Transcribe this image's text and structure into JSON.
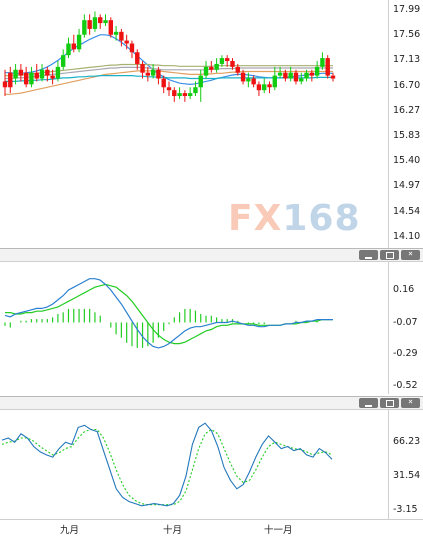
{
  "colors": {
    "up": "#11cc11",
    "down": "#ee1111",
    "ma_blue": "#3a8fe8",
    "ma_orange": "#e0a060",
    "ma_gray": "#a8a8b0",
    "ma_teal": "#18b0c8",
    "ma_olive": "#a8b070",
    "macd_dif": "#2a80d0",
    "macd_dea": "#22cc22",
    "macd_hist": "#22cc22",
    "k_line": "#2277bb",
    "d_line": "#22cc22"
  },
  "watermark": {
    "part1": "FX",
    "part2": "168"
  },
  "panel_buttons": {
    "minimize": "_",
    "restore": "□",
    "close": "×"
  },
  "chart_data": [
    {
      "type": "candlestick",
      "yticks": [
        "17.99",
        "17.56",
        "17.13",
        "16.70",
        "16.27",
        "15.83",
        "15.40",
        "14.97",
        "14.54",
        "14.10"
      ],
      "xticks": [
        "九月",
        "十月",
        "十一月"
      ],
      "ylim": [
        14.1,
        17.99
      ],
      "candles": [
        [
          16.8,
          16.7,
          17.0,
          16.55
        ],
        [
          16.95,
          16.7,
          17.05,
          16.6
        ],
        [
          16.85,
          17.0,
          17.1,
          16.75
        ],
        [
          17.0,
          16.9,
          17.1,
          16.8
        ],
        [
          16.95,
          16.75,
          17.05,
          16.7
        ],
        [
          16.75,
          16.95,
          17.05,
          16.7
        ],
        [
          16.95,
          16.85,
          17.1,
          16.8
        ],
        [
          16.85,
          17.0,
          17.1,
          16.8
        ],
        [
          17.0,
          16.9,
          17.05,
          16.8
        ],
        [
          16.9,
          16.85,
          17.0,
          16.75
        ],
        [
          16.85,
          17.05,
          17.15,
          16.8
        ],
        [
          17.05,
          17.25,
          17.35,
          17.0
        ],
        [
          17.25,
          17.45,
          17.55,
          17.2
        ],
        [
          17.45,
          17.35,
          17.6,
          17.3
        ],
        [
          17.35,
          17.6,
          17.7,
          17.3
        ],
        [
          17.6,
          17.85,
          17.95,
          17.55
        ],
        [
          17.85,
          17.7,
          17.95,
          17.6
        ],
        [
          17.7,
          17.9,
          18.0,
          17.65
        ],
        [
          17.9,
          17.8,
          17.95,
          17.7
        ],
        [
          17.8,
          17.85,
          17.95,
          17.75
        ],
        [
          17.85,
          17.6,
          17.9,
          17.55
        ],
        [
          17.6,
          17.65,
          17.75,
          17.5
        ],
        [
          17.65,
          17.5,
          17.7,
          17.4
        ],
        [
          17.5,
          17.45,
          17.6,
          17.35
        ],
        [
          17.45,
          17.3,
          17.5,
          17.2
        ],
        [
          17.3,
          17.1,
          17.35,
          17.0
        ],
        [
          17.1,
          16.95,
          17.15,
          16.85
        ],
        [
          16.95,
          16.9,
          17.05,
          16.8
        ],
        [
          16.9,
          17.0,
          17.1,
          16.85
        ],
        [
          17.0,
          16.85,
          17.05,
          16.75
        ],
        [
          16.85,
          16.7,
          16.9,
          16.6
        ],
        [
          16.7,
          16.65,
          16.8,
          16.55
        ],
        [
          16.65,
          16.55,
          16.7,
          16.45
        ],
        [
          16.55,
          16.6,
          16.7,
          16.5
        ],
        [
          16.6,
          16.55,
          16.65,
          16.45
        ],
        [
          16.55,
          16.6,
          16.7,
          16.5
        ],
        [
          16.6,
          16.7,
          16.8,
          16.55
        ],
        [
          16.7,
          16.9,
          17.0,
          16.45
        ],
        [
          16.9,
          17.05,
          17.15,
          16.85
        ],
        [
          17.05,
          17.0,
          17.15,
          16.95
        ],
        [
          17.0,
          17.1,
          17.2,
          16.95
        ],
        [
          17.1,
          17.2,
          17.25,
          17.05
        ],
        [
          17.2,
          17.15,
          17.25,
          17.05
        ],
        [
          17.15,
          17.05,
          17.2,
          17.0
        ],
        [
          17.05,
          16.95,
          17.1,
          16.9
        ],
        [
          16.95,
          16.8,
          17.0,
          16.75
        ],
        [
          16.8,
          16.85,
          16.95,
          16.7
        ],
        [
          16.85,
          16.75,
          16.9,
          16.7
        ],
        [
          16.75,
          16.65,
          16.8,
          16.55
        ],
        [
          16.65,
          16.75,
          16.85,
          16.6
        ],
        [
          16.75,
          16.7,
          16.8,
          16.6
        ],
        [
          16.7,
          16.9,
          17.05,
          16.65
        ],
        [
          16.9,
          16.95,
          17.05,
          16.85
        ],
        [
          16.95,
          16.85,
          17.0,
          16.8
        ],
        [
          16.85,
          16.95,
          17.05,
          16.8
        ],
        [
          16.95,
          16.8,
          17.0,
          16.75
        ],
        [
          16.8,
          16.85,
          16.95,
          16.75
        ],
        [
          16.85,
          16.95,
          17.0,
          16.8
        ],
        [
          16.95,
          16.9,
          17.0,
          16.8
        ],
        [
          16.9,
          17.05,
          17.15,
          16.85
        ],
        [
          17.05,
          17.2,
          17.3,
          17.0
        ],
        [
          17.2,
          16.9,
          17.25,
          16.85
        ],
        [
          16.9,
          16.85,
          16.95,
          16.8
        ]
      ],
      "ma": [
        {
          "color_key": "ma_blue",
          "values": [
            16.95,
            16.95,
            16.94,
            16.94,
            16.95,
            16.96,
            16.98,
            17.01,
            17.05,
            17.1,
            17.16,
            17.23,
            17.3,
            17.37,
            17.42,
            17.47,
            17.52,
            17.56,
            17.6,
            17.6,
            17.58,
            17.53,
            17.47,
            17.4,
            17.32,
            17.24,
            17.16,
            17.08,
            17.0,
            16.93,
            16.88,
            16.83,
            16.8,
            16.77,
            16.76,
            16.75,
            16.76,
            16.78,
            16.8,
            16.82,
            16.85,
            16.87,
            16.89,
            16.91,
            16.92,
            16.92,
            16.91,
            16.9,
            16.88,
            16.87,
            16.86,
            16.86,
            16.86,
            16.87,
            16.88,
            16.89,
            16.9,
            16.91,
            16.92,
            16.93,
            16.94,
            16.94,
            16.94
          ]
        },
        {
          "color_key": "ma_orange",
          "values": [
            16.58,
            16.58,
            16.59,
            16.6,
            16.62,
            16.64,
            16.66,
            16.68,
            16.7,
            16.72,
            16.74,
            16.76,
            16.78,
            16.8,
            16.82,
            16.84,
            16.86,
            16.88,
            16.9,
            16.92,
            16.93,
            16.94,
            16.95,
            16.96,
            16.97,
            16.98,
            16.98,
            16.98,
            16.98,
            16.98,
            16.97,
            16.96,
            16.95,
            16.94,
            16.93,
            16.92,
            16.92,
            16.92,
            16.93,
            16.93,
            16.94,
            16.94,
            16.95,
            16.96,
            16.96,
            16.97,
            16.97,
            16.97,
            16.97,
            16.97,
            16.97,
            16.97,
            16.97,
            16.97,
            16.97,
            16.97,
            16.97,
            16.97,
            16.97,
            16.97,
            16.97,
            16.97,
            16.97
          ]
        },
        {
          "color_key": "ma_gray",
          "values": [
            16.85,
            16.85,
            16.86,
            16.86,
            16.87,
            16.88,
            16.89,
            16.9,
            16.91,
            16.92,
            16.93,
            16.94,
            16.95,
            16.96,
            16.97,
            16.98,
            16.99,
            17.0,
            17.01,
            17.02,
            17.03,
            17.03,
            17.04,
            17.04,
            17.04,
            17.04,
            17.04,
            17.03,
            17.02,
            17.01,
            17.0,
            17.0,
            17.0,
            17.0,
            17.0,
            17.0,
            17.0,
            17.0,
            17.0,
            17.01,
            17.01,
            17.02,
            17.02,
            17.02,
            17.03,
            17.03,
            17.03,
            17.03,
            17.03,
            17.03,
            17.03,
            17.03,
            17.03,
            17.03,
            17.03,
            17.03,
            17.03,
            17.03,
            17.03,
            17.03,
            17.03,
            17.03,
            17.03
          ]
        },
        {
          "color_key": "ma_teal",
          "values": [
            16.8,
            16.8,
            16.8,
            16.81,
            16.81,
            16.82,
            16.82,
            16.83,
            16.83,
            16.84,
            16.85,
            16.86,
            16.86,
            16.87,
            16.88,
            16.88,
            16.89,
            16.89,
            16.9,
            16.9,
            16.9,
            16.9,
            16.9,
            16.9,
            16.9,
            16.89,
            16.89,
            16.88,
            16.88,
            16.87,
            16.87,
            16.86,
            16.86,
            16.86,
            16.86,
            16.85,
            16.85,
            16.85,
            16.85,
            16.85,
            16.85,
            16.86,
            16.86,
            16.86,
            16.86,
            16.86,
            16.86,
            16.86,
            16.86,
            16.86,
            16.86,
            16.86,
            16.86,
            16.86,
            16.86,
            16.86,
            16.86,
            16.86,
            16.86,
            16.87,
            16.87,
            16.87,
            16.87
          ]
        },
        {
          "color_key": "ma_olive",
          "values": [
            16.9,
            16.9,
            16.91,
            16.91,
            16.92,
            16.93,
            16.94,
            16.95,
            16.96,
            16.97,
            16.98,
            16.99,
            17.0,
            17.01,
            17.02,
            17.03,
            17.04,
            17.05,
            17.06,
            17.07,
            17.08,
            17.08,
            17.09,
            17.09,
            17.09,
            17.09,
            17.09,
            17.09,
            17.08,
            17.08,
            17.07,
            17.07,
            17.07,
            17.06,
            17.06,
            17.06,
            17.06,
            17.06,
            17.06,
            17.06,
            17.07,
            17.07,
            17.07,
            17.07,
            17.07,
            17.07,
            17.07,
            17.07,
            17.07,
            17.07,
            17.07,
            17.07,
            17.07,
            17.07,
            17.07,
            17.07,
            17.07,
            17.07,
            17.07,
            17.07,
            17.07,
            17.07,
            17.07
          ]
        }
      ]
    },
    {
      "type": "macd",
      "yticks": [
        "0.16",
        "-0.07",
        "-0.29",
        "-0.52"
      ],
      "ylim": [
        -0.52,
        0.16
      ],
      "dif": [
        -0.02,
        -0.03,
        -0.01,
        0.0,
        0.01,
        0.02,
        0.03,
        0.03,
        0.04,
        0.06,
        0.09,
        0.12,
        0.16,
        0.18,
        0.2,
        0.22,
        0.24,
        0.24,
        0.23,
        0.2,
        0.16,
        0.11,
        0.06,
        0.0,
        -0.06,
        -0.12,
        -0.17,
        -0.21,
        -0.24,
        -0.25,
        -0.24,
        -0.22,
        -0.19,
        -0.16,
        -0.13,
        -0.11,
        -0.1,
        -0.1,
        -0.09,
        -0.08,
        -0.07,
        -0.07,
        -0.07,
        -0.06,
        -0.07,
        -0.08,
        -0.09,
        -0.09,
        -0.1,
        -0.1,
        -0.09,
        -0.09,
        -0.09,
        -0.08,
        -0.08,
        -0.07,
        -0.07,
        -0.06,
        -0.06,
        -0.05,
        -0.05,
        -0.05,
        -0.05
      ],
      "dea": [
        0.0,
        0.0,
        -0.01,
        -0.01,
        0.0,
        0.0,
        0.01,
        0.01,
        0.02,
        0.03,
        0.04,
        0.06,
        0.08,
        0.1,
        0.12,
        0.14,
        0.16,
        0.18,
        0.19,
        0.2,
        0.19,
        0.18,
        0.15,
        0.12,
        0.08,
        0.03,
        -0.02,
        -0.07,
        -0.12,
        -0.16,
        -0.19,
        -0.21,
        -0.22,
        -0.22,
        -0.21,
        -0.19,
        -0.17,
        -0.15,
        -0.13,
        -0.12,
        -0.1,
        -0.09,
        -0.09,
        -0.08,
        -0.08,
        -0.08,
        -0.08,
        -0.08,
        -0.09,
        -0.09,
        -0.09,
        -0.09,
        -0.09,
        -0.08,
        -0.08,
        -0.08,
        -0.07,
        -0.07,
        -0.06,
        -0.06,
        -0.05,
        -0.05,
        -0.05
      ]
    },
    {
      "type": "kd",
      "yticks": [
        "66.23",
        "31.54",
        "-3.15"
      ],
      "ylim": [
        -3.15,
        100
      ],
      "k": [
        66,
        68,
        64,
        72,
        68,
        60,
        55,
        52,
        50,
        58,
        64,
        62,
        78,
        80,
        76,
        74,
        56,
        38,
        20,
        12,
        8,
        6,
        4,
        5,
        6,
        5,
        4,
        6,
        14,
        32,
        62,
        78,
        82,
        75,
        60,
        40,
        28,
        20,
        24,
        36,
        50,
        62,
        70,
        64,
        58,
        60,
        56,
        58,
        52,
        50,
        58,
        54,
        48
      ],
      "d": [
        62,
        64,
        65,
        68,
        68,
        65,
        60,
        56,
        52,
        54,
        58,
        60,
        68,
        74,
        76,
        76,
        68,
        54,
        38,
        24,
        14,
        9,
        6,
        5,
        5,
        5,
        5,
        5,
        8,
        18,
        38,
        58,
        72,
        76,
        72,
        58,
        44,
        32,
        26,
        28,
        38,
        50,
        60,
        64,
        62,
        60,
        58,
        57,
        55,
        52,
        54,
        55,
        52
      ]
    }
  ]
}
